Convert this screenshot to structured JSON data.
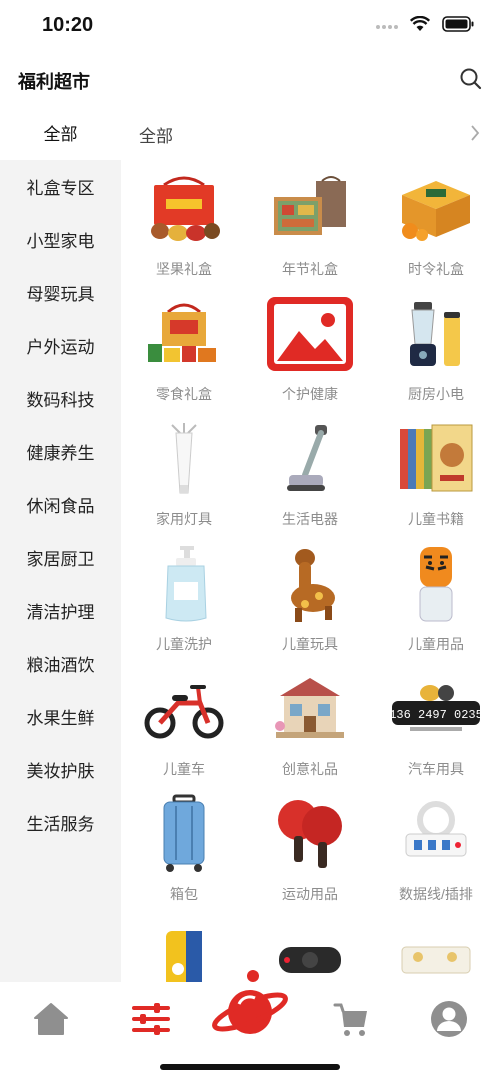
{
  "status_bar": {
    "time": "10:20"
  },
  "header": {
    "title": "福利超市"
  },
  "category_row": {
    "left_label": "全部",
    "right_label": "全部"
  },
  "sidebar": {
    "items": [
      "礼盒专区",
      "小型家电",
      "母婴玩具",
      "户外运动",
      "数码科技",
      "健康养生",
      "休闲食品",
      "家居厨卫",
      "清洁护理",
      "粮油酒饮",
      "水果生鲜",
      "美妆护肤",
      "生活服务"
    ]
  },
  "grid": {
    "items": [
      {
        "label": "坚果礼盒",
        "icon": "nut-gift-box-icon"
      },
      {
        "label": "年节礼盒",
        "icon": "festival-gift-box-icon"
      },
      {
        "label": "时令礼盒",
        "icon": "seasonal-fruit-box-icon"
      },
      {
        "label": "零食礼盒",
        "icon": "snack-gift-box-icon"
      },
      {
        "label": "个护健康",
        "icon": "image-placeholder-icon"
      },
      {
        "label": "厨房小电",
        "icon": "blender-icon"
      },
      {
        "label": "家用灯具",
        "icon": "lamp-icon"
      },
      {
        "label": "生活电器",
        "icon": "floor-cleaner-icon"
      },
      {
        "label": "儿童书籍",
        "icon": "books-icon"
      },
      {
        "label": "儿童洗护",
        "icon": "lotion-bottle-icon"
      },
      {
        "label": "儿童玩具",
        "icon": "giraffe-toy-icon"
      },
      {
        "label": "儿童用品",
        "icon": "tiger-bottle-icon"
      },
      {
        "label": "儿童车",
        "icon": "balance-bike-icon"
      },
      {
        "label": "创意礼品",
        "icon": "miniature-house-icon"
      },
      {
        "label": "汽车用具",
        "icon": "parking-number-plate-icon"
      },
      {
        "label": "箱包",
        "icon": "suitcase-icon"
      },
      {
        "label": "运动用品",
        "icon": "ping-pong-paddles-icon"
      },
      {
        "label": "数据线/插排",
        "icon": "power-strip-icon"
      },
      {
        "label": "",
        "icon": "yellow-box-icon"
      },
      {
        "label": "",
        "icon": "speaker-icon"
      },
      {
        "label": "",
        "icon": "white-device-icon"
      }
    ],
    "parking_plate_text": "136 2497 0235"
  },
  "tabbar": {
    "tabs": [
      {
        "icon": "home-icon"
      },
      {
        "icon": "category-sliders-icon"
      },
      {
        "icon": "planet-icon"
      },
      {
        "icon": "cart-icon"
      },
      {
        "icon": "profile-icon"
      }
    ]
  },
  "colors": {
    "accent": "#e02a25",
    "sidebar_bg": "#f3f3f3",
    "label_gray": "#8d8d8d",
    "tab_gray": "#8f8f8f"
  }
}
